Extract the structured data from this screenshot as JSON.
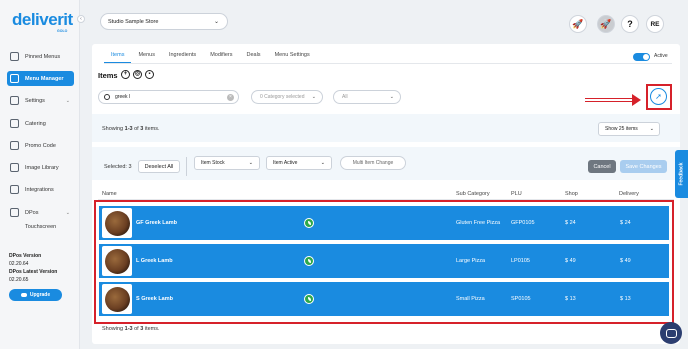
{
  "brand": {
    "logo": "deliverit",
    "logo_sub": "GOLO"
  },
  "sidebar": {
    "items": [
      {
        "label": "Pinned Menus",
        "icon": "pin-icon"
      },
      {
        "label": "Menu Manager",
        "icon": "menu-icon",
        "active": true
      },
      {
        "label": "Settings",
        "icon": "gear-icon",
        "expandable": true
      },
      {
        "label": "Catering",
        "icon": "catering-icon"
      },
      {
        "label": "Promo Code",
        "icon": "promo-icon"
      },
      {
        "label": "Image Library",
        "icon": "image-icon"
      },
      {
        "label": "Integrations",
        "icon": "integrations-icon"
      },
      {
        "label": "DPos",
        "icon": "pos-icon",
        "expandable": true
      }
    ],
    "sub_item": "Touchscreen",
    "dpos_version_label": "DPos Version",
    "dpos_version": "02.20.64",
    "dpos_latest_label": "DPos Latest Version",
    "dpos_latest": "02.20.65",
    "upgrade_label": "Upgrade"
  },
  "header": {
    "store": "Studio Sample Store",
    "question_icon": "?",
    "user_initials": "RE"
  },
  "tabs": [
    "Items",
    "Menus",
    "Ingredients",
    "Modifiers",
    "Deals",
    "Menu Settings"
  ],
  "active_tab": "Items",
  "toggle_label": "Active",
  "items_title": "Items",
  "filters": {
    "search_value": "greek l",
    "category_placeholder": "0 Category selected",
    "status_value": "All"
  },
  "showing_prefix": "Showing ",
  "showing_range": "1-3",
  "showing_mid": " of ",
  "showing_total": "3",
  "showing_suffix": " items.",
  "page_size": "Show 25 items",
  "bulk": {
    "selected": "Selected: 3",
    "deselect": "Deselect All",
    "item_stock": "Item Stock",
    "item_active": "Item Active",
    "multi_change": "Multi Item Change",
    "cancel": "Cancel",
    "save": "Save Changes"
  },
  "columns": [
    "Name",
    "Sub Category",
    "PLU",
    "Shop",
    "Delivery"
  ],
  "rows": [
    {
      "name": "GF Greek Lamb",
      "sub_category": "Gluten Free Pizza",
      "plu": "GFP0105",
      "shop": "$ 24",
      "delivery": "$ 24"
    },
    {
      "name": "L Greek Lamb",
      "sub_category": "Large Pizza",
      "plu": "LP0105",
      "shop": "$ 49",
      "delivery": "$ 49"
    },
    {
      "name": "S Greek Lamb",
      "sub_category": "Small Pizza",
      "plu": "SP0105",
      "shop": "$ 13",
      "delivery": "$ 13"
    }
  ],
  "feedback_label": "Feedback",
  "colors": {
    "accent": "#1a8be0",
    "highlight": "#d6212a"
  }
}
